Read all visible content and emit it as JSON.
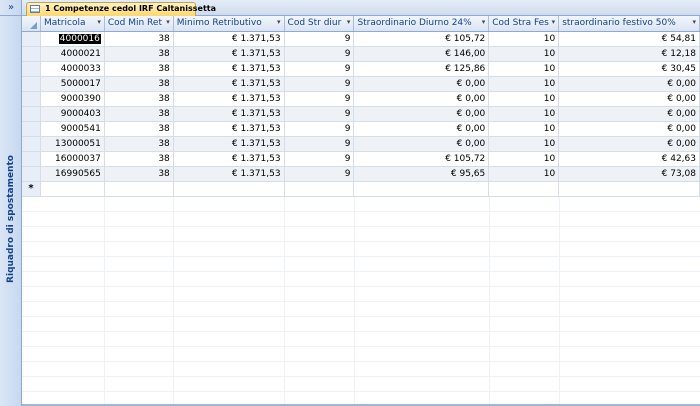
{
  "nav_pane": {
    "toggle_label": "»",
    "title": "Riquadro di spostamento"
  },
  "tab": {
    "label": "1 Competenze cedol IRF Caltanissetta"
  },
  "columns": [
    "Matricola",
    "Cod Min Ret",
    "Minimo Retributivo",
    "Cod Str diur",
    "Straordinario Diurno 24%",
    "Cod Stra Fes",
    "straordinario festivo 50%"
  ],
  "rows": [
    [
      "4000016",
      "38",
      "€ 1.371,53",
      "9",
      "€ 105,72",
      "10",
      "€ 54,81"
    ],
    [
      "4000021",
      "38",
      "€ 1.371,53",
      "9",
      "€ 146,00",
      "10",
      "€ 12,18"
    ],
    [
      "4000033",
      "38",
      "€ 1.371,53",
      "9",
      "€ 125,86",
      "10",
      "€ 30,45"
    ],
    [
      "5000017",
      "38",
      "€ 1.371,53",
      "9",
      "€ 0,00",
      "10",
      "€ 0,00"
    ],
    [
      "9000390",
      "38",
      "€ 1.371,53",
      "9",
      "€ 0,00",
      "10",
      "€ 0,00"
    ],
    [
      "9000403",
      "38",
      "€ 1.371,53",
      "9",
      "€ 0,00",
      "10",
      "€ 0,00"
    ],
    [
      "9000541",
      "38",
      "€ 1.371,53",
      "9",
      "€ 0,00",
      "10",
      "€ 0,00"
    ],
    [
      "13000051",
      "38",
      "€ 1.371,53",
      "9",
      "€ 0,00",
      "10",
      "€ 0,00"
    ],
    [
      "16000037",
      "38",
      "€ 1.371,53",
      "9",
      "€ 105,72",
      "10",
      "€ 42,63"
    ],
    [
      "16990565",
      "38",
      "€ 1.371,53",
      "9",
      "€ 95,65",
      "10",
      "€ 73,08"
    ]
  ],
  "new_row_marker": "*",
  "icons": {
    "nav_toggle": "double-chevron-right-icon",
    "tab": "table-icon",
    "sort": "dropdown-arrow-icon",
    "select_all": "select-all-corner-icon"
  },
  "colors": {
    "tab_active": "#ffd66b",
    "header": "#d9e4f3",
    "row_alt": "#eef1f6",
    "nav_text": "#15428b"
  }
}
